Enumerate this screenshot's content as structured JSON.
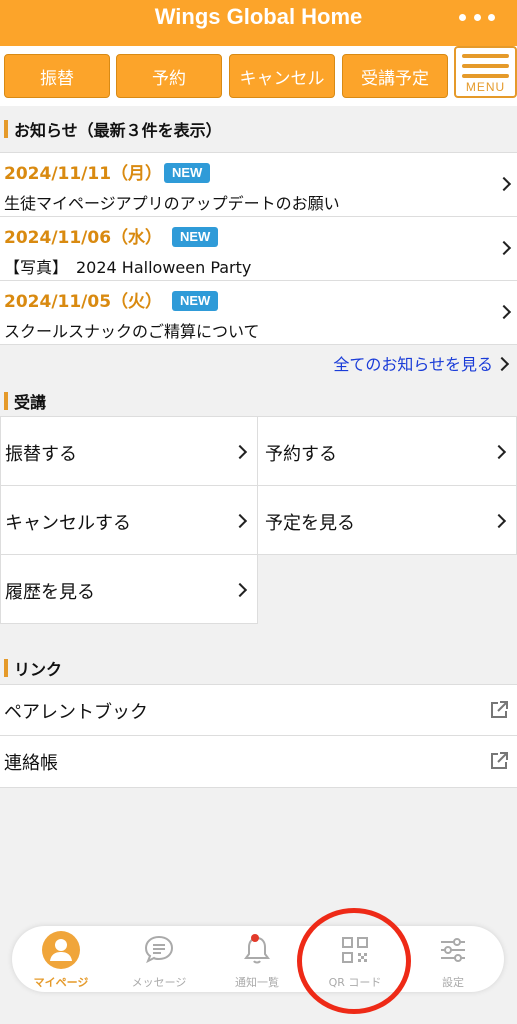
{
  "header": {
    "title": "Wings Global Home",
    "more_icon": "more-dots-icon"
  },
  "top_buttons": [
    "振替",
    "予約",
    "キャンセル",
    "受講予定"
  ],
  "menu_label": "MENU",
  "news": {
    "title": "お知らせ（最新３件を表示）",
    "items": [
      {
        "date": "2024/11/11（月）",
        "badge": "NEW",
        "text": "生徒マイページアプリのアップデートのお願い"
      },
      {
        "date": "2024/11/06（水）",
        "badge": "NEW",
        "text": "【写真】　2024 Halloween Party"
      },
      {
        "date": "2024/11/05（火）",
        "badge": "NEW",
        "text": "スクールスナックのご精算について"
      }
    ],
    "all_link": "全てのお知らせを見る"
  },
  "lessons": {
    "title": "受講",
    "items": [
      "振替する",
      "予約する",
      "キャンセルする",
      "予定を見る",
      "履歴を見る"
    ]
  },
  "links": {
    "title": "リンク",
    "items": [
      "ペアレントブック",
      "連絡帳"
    ]
  },
  "tabbar": {
    "items": [
      {
        "label": "マイページ",
        "icon": "user-icon",
        "active": true
      },
      {
        "label": "メッセージ",
        "icon": "chat-icon",
        "active": false
      },
      {
        "label": "通知一覧",
        "icon": "bell-icon",
        "active": false
      },
      {
        "label": "QR コード",
        "icon": "qr-code-icon",
        "active": false
      },
      {
        "label": "設定",
        "icon": "sliders-icon",
        "active": false
      }
    ]
  },
  "colors": {
    "accent": "#fca42a",
    "badge": "#2f9bd8",
    "link": "#1a3cd8",
    "highlight": "#ee2a17"
  }
}
